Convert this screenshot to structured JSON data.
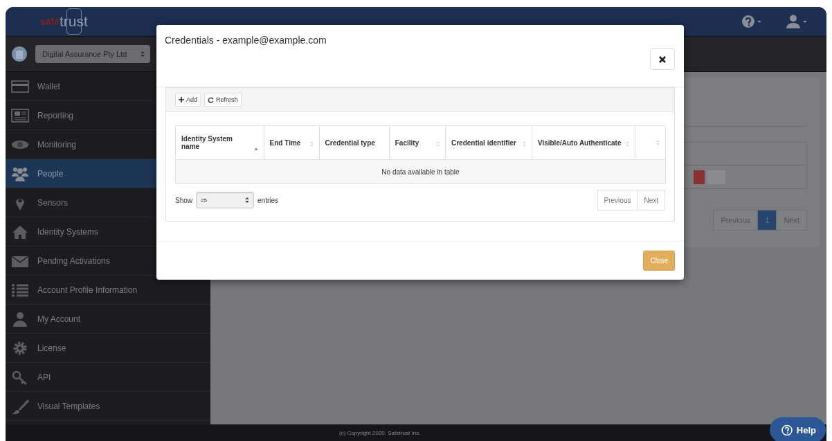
{
  "header": {
    "logo": {
      "prefix": "safe",
      "name": "trust"
    }
  },
  "org_selector": {
    "value": "Digital Assurance Pty Ltd"
  },
  "sidebar": {
    "items": [
      {
        "label": "Wallet",
        "kind": "card",
        "selected": false
      },
      {
        "label": "Reporting",
        "kind": "report",
        "selected": false
      },
      {
        "label": "Monitoring",
        "kind": "eye",
        "selected": false
      },
      {
        "label": "People",
        "kind": "people",
        "selected": true
      },
      {
        "label": "Sensors",
        "kind": "pin",
        "selected": false
      },
      {
        "label": "Identity Systems",
        "kind": "house",
        "selected": false
      },
      {
        "label": "Pending Activations",
        "kind": "envelope",
        "selected": false
      },
      {
        "label": "Account Profile Information",
        "kind": "list",
        "selected": false
      },
      {
        "label": "My Account",
        "kind": "person",
        "selected": false
      },
      {
        "label": "License",
        "kind": "gear",
        "selected": false
      },
      {
        "label": "API",
        "kind": "key",
        "selected": false
      },
      {
        "label": "Visual Templates",
        "kind": "brush",
        "selected": false
      }
    ]
  },
  "background_page": {
    "pager": [
      {
        "label": "Previous",
        "selected": false
      },
      {
        "label": "1",
        "selected": true
      },
      {
        "label": "Next",
        "selected": false
      }
    ]
  },
  "modal": {
    "title": "Credentials - example@example.com",
    "toolbar": [
      {
        "label": "Add",
        "kind": "add"
      },
      {
        "label": "Refresh",
        "kind": "refresh"
      }
    ],
    "table": {
      "columns": [
        {
          "label": "Identity System name",
          "sortable": true,
          "sorted": true
        },
        {
          "label": "End Time",
          "sortable": true,
          "sorted": false
        },
        {
          "label": "Credential type",
          "sortable": false,
          "sorted": false
        },
        {
          "label": "Facility",
          "sortable": true,
          "sorted": false
        },
        {
          "label": "Credential identifier",
          "sortable": true,
          "sorted": false
        },
        {
          "label": "Visible/Auto Authenticate",
          "sortable": true,
          "sorted": false
        },
        {
          "sortable": true,
          "sorted": false
        }
      ],
      "empty_message": "No data available in table"
    },
    "length": {
      "label_before": "Show",
      "value": "25",
      "label_after": "entries"
    },
    "pager": [
      {
        "label": "Previous"
      },
      {
        "label": "Next"
      }
    ],
    "close_button": "Close"
  },
  "footer": {
    "copyright": "(c) Copyright 2020, Safetrust Inc."
  },
  "help_button": "Help"
}
